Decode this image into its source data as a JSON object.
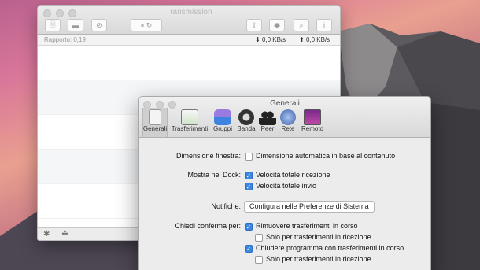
{
  "transmission": {
    "title": "Transmission",
    "ratio": "Rapporto: 0,19",
    "download_speed": "0,0 KB/s",
    "upload_speed": "0,0 KB/s"
  },
  "preferences": {
    "title": "Generali",
    "tabs": [
      {
        "label": "Generali",
        "icon": "switch-icon"
      },
      {
        "label": "Trasferimenti",
        "icon": "monitor-icon"
      },
      {
        "label": "Gruppi",
        "icon": "groups-icon"
      },
      {
        "label": "Banda",
        "icon": "speedometer-icon"
      },
      {
        "label": "Peer",
        "icon": "people-icon"
      },
      {
        "label": "Rete",
        "icon": "globe-icon"
      },
      {
        "label": "Remoto",
        "icon": "remote-icon"
      }
    ],
    "window_size_label": "Dimensione finestra:",
    "window_size_option": "Dimensione automatica in base al contenuto",
    "dock_label": "Mostra nel Dock:",
    "dock_option_1": "Velocità totale ricezione",
    "dock_option_2": "Velocità totale invio",
    "notifications_label": "Notifiche:",
    "notifications_button": "Configura nelle Preferenze di Sistema",
    "confirm_label": "Chiedi conferma per:",
    "confirm_option_1": "Rimuovere trasferimenti in corso",
    "confirm_option_1_sub": "Solo per trasferimenti in ricezione",
    "confirm_option_2": "Chiudere programma con trasferimenti in corso",
    "confirm_option_2_sub": "Solo per trasferimenti in ricezione",
    "checks": {
      "window_size": false,
      "dock_1": true,
      "dock_2": true,
      "confirm_1": true,
      "confirm_1_sub": false,
      "confirm_2": true,
      "confirm_2_sub": false
    }
  },
  "colors": {
    "checkbox_on": "#3c87e0"
  }
}
